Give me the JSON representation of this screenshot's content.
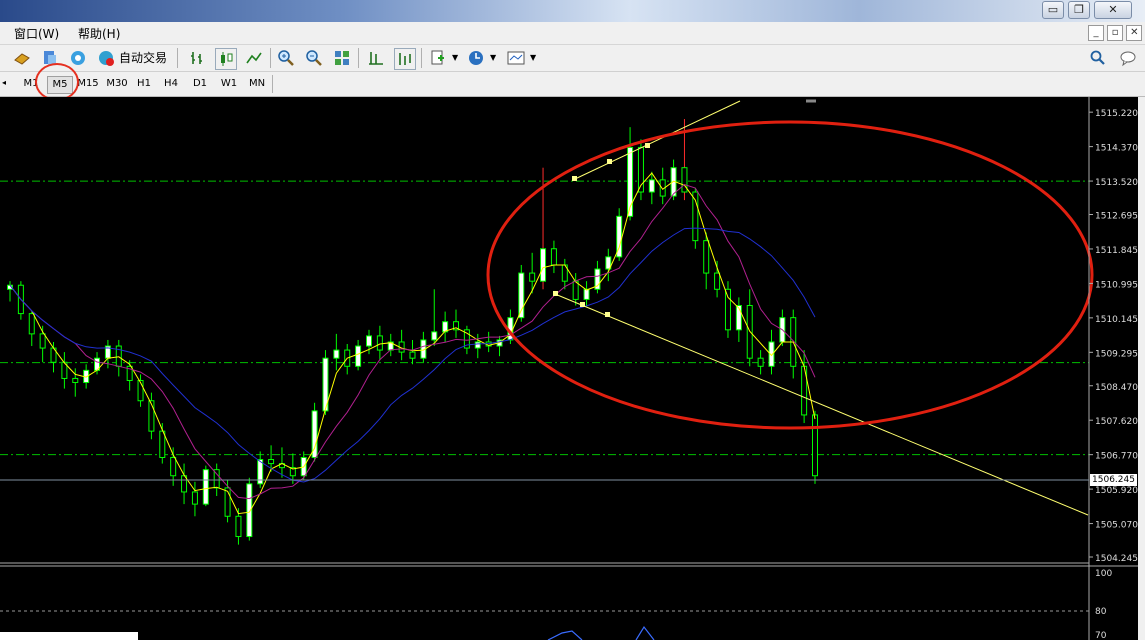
{
  "window": {
    "buttons": [
      "▭",
      "❐",
      "✕"
    ]
  },
  "menu": {
    "window_label": "窗口(W)",
    "help_label": "帮助(H)"
  },
  "toolbar": {
    "autotrade_label": "自动交易"
  },
  "timeframes": [
    "M1",
    "M5",
    "M15",
    "M30",
    "H1",
    "H4",
    "D1",
    "W1",
    "MN"
  ],
  "active_timeframe": "M5",
  "colors": {
    "bull_candle": "#ffffff",
    "bull_outline": "#00ff00",
    "bear_candle": "#000000",
    "bear_outline": "#00ff00",
    "wick_red": "#ff2b2b",
    "ma_fast": "#ffff00",
    "ma_mid": "#b0208f",
    "ma_slow": "#2030d0",
    "grid_dash": "#00c000",
    "trendline": "#ffff80",
    "highlight_ellipse": "#e02010"
  },
  "chart_data": {
    "type": "candlestick",
    "price_axis_labels": [
      "1515.220",
      "1514.370",
      "1513.520",
      "1512.695",
      "1511.845",
      "1510.995",
      "1510.145",
      "1509.295",
      "1508.470",
      "1507.620",
      "1506.770",
      "1505.920",
      "1505.070",
      "1504.245"
    ],
    "current_price": "1506.245",
    "ylim": [
      1504.245,
      1515.52
    ],
    "horizontal_levels": [
      1513.52,
      1509.04,
      1506.77
    ],
    "indicator_panel": {
      "labels": [
        "100",
        "80",
        "70"
      ],
      "levels": [
        80
      ]
    },
    "candles_ohlc": [
      [
        1510.85,
        1511.05,
        1510.55,
        1510.95
      ],
      [
        1510.95,
        1511.05,
        1510.1,
        1510.25
      ],
      [
        1510.25,
        1510.3,
        1509.45,
        1509.75
      ],
      [
        1509.75,
        1509.95,
        1509.05,
        1509.4
      ],
      [
        1509.4,
        1509.55,
        1508.8,
        1509.05
      ],
      [
        1509.05,
        1509.3,
        1508.4,
        1508.65
      ],
      [
        1508.65,
        1508.9,
        1508.2,
        1508.55
      ],
      [
        1508.55,
        1509.0,
        1508.4,
        1508.85
      ],
      [
        1508.85,
        1509.3,
        1508.75,
        1509.15
      ],
      [
        1509.15,
        1509.6,
        1508.9,
        1509.45
      ],
      [
        1509.45,
        1509.6,
        1508.7,
        1508.95
      ],
      [
        1508.95,
        1509.1,
        1508.35,
        1508.6
      ],
      [
        1508.6,
        1508.75,
        1507.95,
        1508.1
      ],
      [
        1508.1,
        1508.3,
        1507.15,
        1507.35
      ],
      [
        1507.35,
        1507.55,
        1506.55,
        1506.7
      ],
      [
        1506.7,
        1506.95,
        1506.0,
        1506.25
      ],
      [
        1506.25,
        1506.55,
        1505.55,
        1505.85
      ],
      [
        1505.85,
        1506.1,
        1505.25,
        1505.55
      ],
      [
        1505.55,
        1506.5,
        1505.5,
        1506.4
      ],
      [
        1506.4,
        1506.55,
        1505.75,
        1505.95
      ],
      [
        1505.95,
        1506.15,
        1505.1,
        1505.25
      ],
      [
        1505.25,
        1505.45,
        1504.55,
        1504.75
      ],
      [
        1504.75,
        1506.2,
        1504.65,
        1506.05
      ],
      [
        1506.05,
        1506.85,
        1505.95,
        1506.65
      ],
      [
        1506.65,
        1507.0,
        1506.35,
        1506.55
      ],
      [
        1506.55,
        1506.95,
        1506.2,
        1506.45
      ],
      [
        1506.45,
        1506.8,
        1506.05,
        1506.25
      ],
      [
        1506.25,
        1506.85,
        1506.15,
        1506.7
      ],
      [
        1506.7,
        1508.05,
        1506.6,
        1507.85
      ],
      [
        1507.85,
        1509.35,
        1507.75,
        1509.15
      ],
      [
        1509.15,
        1509.75,
        1508.85,
        1509.35
      ],
      [
        1509.35,
        1509.5,
        1508.75,
        1508.95
      ],
      [
        1508.95,
        1509.6,
        1508.85,
        1509.45
      ],
      [
        1509.45,
        1509.85,
        1509.25,
        1509.7
      ],
      [
        1509.7,
        1509.95,
        1509.1,
        1509.35
      ],
      [
        1509.35,
        1509.75,
        1509.2,
        1509.55
      ],
      [
        1509.55,
        1509.85,
        1509.1,
        1509.3
      ],
      [
        1509.3,
        1509.6,
        1509.0,
        1509.15
      ],
      [
        1509.15,
        1509.8,
        1509.05,
        1509.6
      ],
      [
        1509.6,
        1510.85,
        1509.45,
        1509.8
      ],
      [
        1509.8,
        1510.3,
        1509.55,
        1510.05
      ],
      [
        1510.05,
        1510.35,
        1509.65,
        1509.85
      ],
      [
        1509.85,
        1509.95,
        1509.25,
        1509.4
      ],
      [
        1509.4,
        1509.75,
        1509.15,
        1509.55
      ],
      [
        1509.55,
        1509.8,
        1509.3,
        1509.45
      ],
      [
        1509.45,
        1509.7,
        1509.2,
        1509.6
      ],
      [
        1509.6,
        1510.35,
        1509.5,
        1510.15
      ],
      [
        1510.15,
        1511.45,
        1510.05,
        1511.25
      ],
      [
        1511.25,
        1511.75,
        1510.75,
        1511.05
      ],
      [
        1511.05,
        1513.85,
        1510.85,
        1511.85
      ],
      [
        1511.85,
        1512.05,
        1511.25,
        1511.45
      ],
      [
        1511.45,
        1511.6,
        1510.85,
        1511.05
      ],
      [
        1511.05,
        1511.25,
        1510.45,
        1510.6
      ],
      [
        1510.6,
        1511.05,
        1510.45,
        1510.85
      ],
      [
        1510.85,
        1511.55,
        1510.75,
        1511.35
      ],
      [
        1511.35,
        1511.85,
        1511.05,
        1511.65
      ],
      [
        1511.65,
        1512.85,
        1511.55,
        1512.65
      ],
      [
        1512.65,
        1514.85,
        1512.55,
        1514.35
      ],
      [
        1514.35,
        1514.55,
        1513.05,
        1513.25
      ],
      [
        1513.25,
        1513.75,
        1512.95,
        1513.55
      ],
      [
        1513.55,
        1513.85,
        1512.95,
        1513.15
      ],
      [
        1513.15,
        1514.05,
        1513.05,
        1513.85
      ],
      [
        1513.85,
        1515.05,
        1513.05,
        1513.25
      ],
      [
        1513.25,
        1513.35,
        1511.85,
        1512.05
      ],
      [
        1512.05,
        1512.25,
        1510.85,
        1511.25
      ],
      [
        1511.25,
        1511.55,
        1510.65,
        1510.85
      ],
      [
        1510.85,
        1511.05,
        1509.65,
        1509.85
      ],
      [
        1509.85,
        1510.65,
        1509.55,
        1510.45
      ],
      [
        1510.45,
        1510.85,
        1508.95,
        1509.15
      ],
      [
        1509.15,
        1509.35,
        1508.75,
        1508.95
      ],
      [
        1508.95,
        1509.85,
        1508.75,
        1509.55
      ],
      [
        1509.55,
        1510.35,
        1509.45,
        1510.15
      ],
      [
        1510.15,
        1510.35,
        1508.65,
        1508.95
      ],
      [
        1508.95,
        1509.35,
        1507.55,
        1507.75
      ],
      [
        1507.75,
        1507.85,
        1506.05,
        1506.25
      ]
    ]
  }
}
